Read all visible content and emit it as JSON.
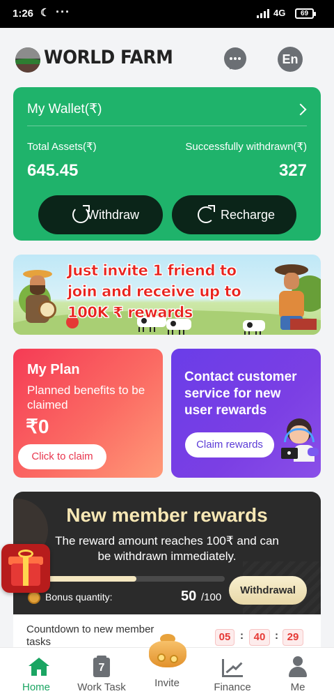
{
  "status_bar": {
    "time": "1:26",
    "network": "4G",
    "battery": "69"
  },
  "header": {
    "brand": "WORLD FARM",
    "language_button": "En"
  },
  "wallet": {
    "title": "My Wallet(₹)",
    "total_assets_label": "Total Assets(₹)",
    "total_assets_value": "645.45",
    "withdrawn_label": "Successfully withdrawn(₹)",
    "withdrawn_value": "327",
    "withdraw_button": "Withdraw",
    "recharge_button": "Recharge"
  },
  "banner": {
    "text": "Just invite 1 friend to join and receive up to 100K ₹ rewards"
  },
  "plan_card": {
    "title": "My Plan",
    "subtitle": "Planned benefits to be claimed",
    "value": "₹0",
    "button": "Click to claim"
  },
  "contact_card": {
    "title": "Contact customer service for new user rewards",
    "button": "Claim rewards"
  },
  "rewards": {
    "title": "New member rewards",
    "subtitle": "The reward amount reaches 100₹ and can be withdrawn immediately.",
    "progress_fraction": 0.5,
    "bonus_label": "Bonus quantity:",
    "bonus_value": "50",
    "bonus_max": "/100",
    "withdraw_button": "Withdrawal"
  },
  "countdown": {
    "label": "Countdown to new member tasks",
    "hours": "05",
    "minutes": "40",
    "seconds": "29"
  },
  "nav": {
    "items": [
      {
        "label": "Home",
        "icon": "home-icon",
        "active": true
      },
      {
        "label": "Work Task",
        "icon": "calendar-icon",
        "badge": "7"
      },
      {
        "label": "Invite",
        "icon": "money-bag-icon"
      },
      {
        "label": "Finance",
        "icon": "chart-icon"
      },
      {
        "label": "Me",
        "icon": "user-icon"
      }
    ]
  },
  "colors": {
    "wallet_green": "#1fb36b",
    "plan_red": "#f53b55",
    "contact_purple": "#6a3de8",
    "active_nav": "#1aa562",
    "promo_red": "#e8231e"
  }
}
